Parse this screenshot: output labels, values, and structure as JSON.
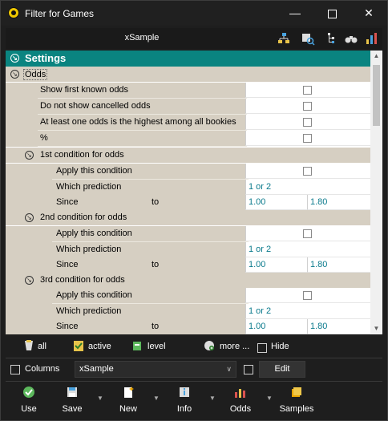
{
  "window": {
    "title": "Filter for Games"
  },
  "toolbar": {
    "profile": "xSample"
  },
  "settings": {
    "header": "Settings",
    "odds_label": "Odds",
    "rows": [
      {
        "label": "Show first known odds"
      },
      {
        "label": "Do not show cancelled odds"
      },
      {
        "label": "At least one odds is the highest among all bookies"
      },
      {
        "label": "%"
      }
    ],
    "conditions": [
      {
        "title": "1st condition for odds",
        "apply": "Apply this condition",
        "which": "Which prediction",
        "which_val": "1 or 2",
        "since": "Since",
        "to": "to",
        "from_val": "1.00",
        "to_val": "1.80"
      },
      {
        "title": "2nd condition for odds",
        "apply": "Apply this condition",
        "which": "Which prediction",
        "which_val": "1 or 2",
        "since": "Since",
        "to": "to",
        "from_val": "1.00",
        "to_val": "1.80"
      },
      {
        "title": "3rd condition for odds",
        "apply": "Apply this condition",
        "which": "Which prediction",
        "which_val": "1 or 2",
        "since": "Since",
        "to": "to",
        "from_val": "1.00",
        "to_val": "1.80"
      }
    ]
  },
  "filterbar": {
    "all": "all",
    "active": "active",
    "level": "level",
    "more": "more ...",
    "hide": "Hide"
  },
  "columnsbar": {
    "columns": "Columns",
    "combo_value": "xSample",
    "edit": "Edit"
  },
  "actions": {
    "use": "Use",
    "save": "Save",
    "new": "New",
    "info": "Info",
    "odds": "Odds",
    "samples": "Samples"
  }
}
